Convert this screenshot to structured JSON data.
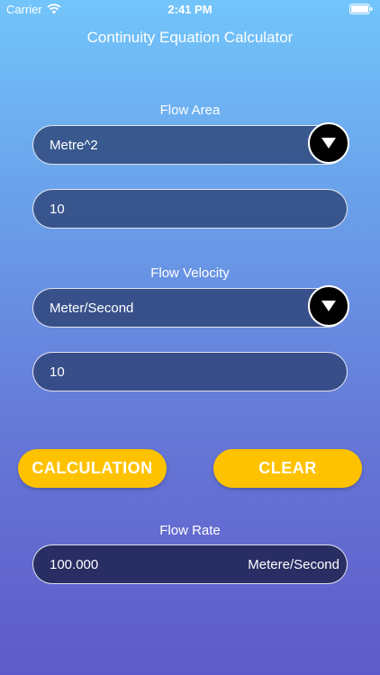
{
  "status_bar": {
    "carrier": "Carrier",
    "time": "2:41 PM"
  },
  "app": {
    "title": "Continuity Equation Calculator"
  },
  "flow_area": {
    "label": "Flow Area",
    "unit_selected": "Metre^2",
    "value": "10"
  },
  "flow_velocity": {
    "label": "Flow Velocity",
    "unit_selected": "Meter/Second",
    "value": "10"
  },
  "buttons": {
    "calculate_label": "CALCULATION",
    "clear_label": "CLEAR"
  },
  "flow_rate": {
    "label": "Flow Rate",
    "value": "100.000",
    "unit": "Metere/Second"
  },
  "colors": {
    "button": "#FFC200",
    "gradient_top": "#72C5FB",
    "gradient_bottom": "#5F5AC9"
  },
  "icons": [
    "wifi-icon",
    "battery-icon",
    "dropdown-arrow-icon"
  ]
}
